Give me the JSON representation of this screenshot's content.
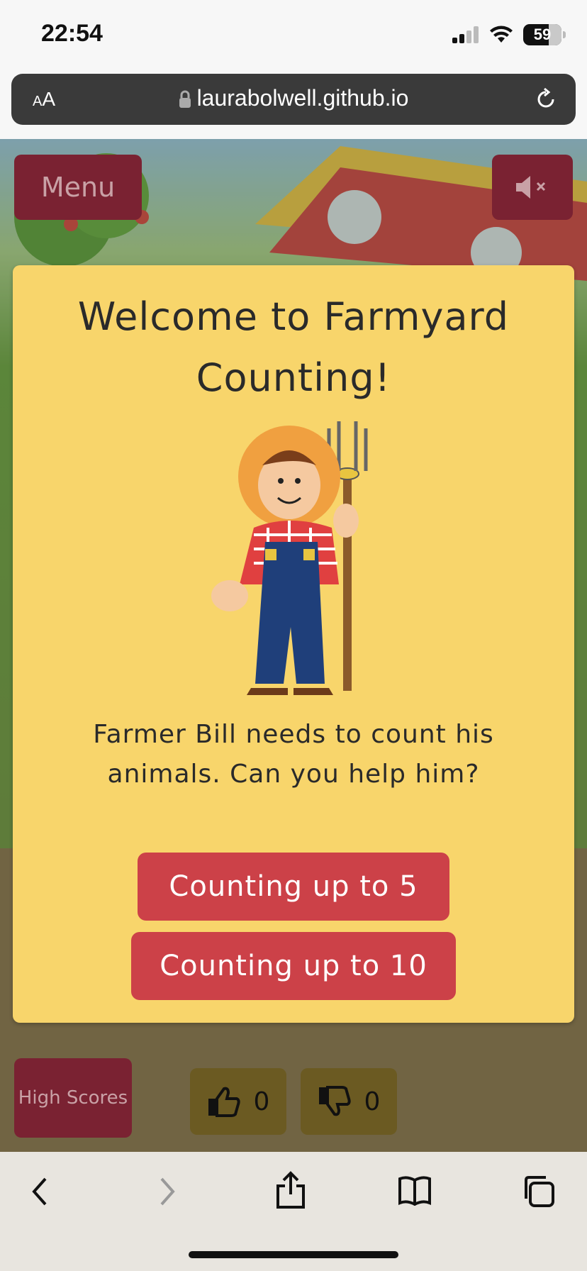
{
  "status_bar": {
    "time": "22:54",
    "battery": "59"
  },
  "browser": {
    "text_size_label_small": "A",
    "text_size_label_large": "A",
    "url": "laurabolwell.github.io"
  },
  "game": {
    "menu_label": "Menu",
    "welcome_title": "Welcome to Farmyard Counting!",
    "intro_text": "Farmer Bill needs to count his animals. Can you help him?",
    "levels": [
      {
        "label": "Counting up to 5"
      },
      {
        "label": "Counting up to 10"
      }
    ],
    "high_scores_label": "High Scores",
    "likes_count": "0",
    "dislikes_count": "0"
  },
  "colors": {
    "accent_red": "#cc4148",
    "modal_yellow": "#f8d56b",
    "dark_red": "#7a2232"
  }
}
